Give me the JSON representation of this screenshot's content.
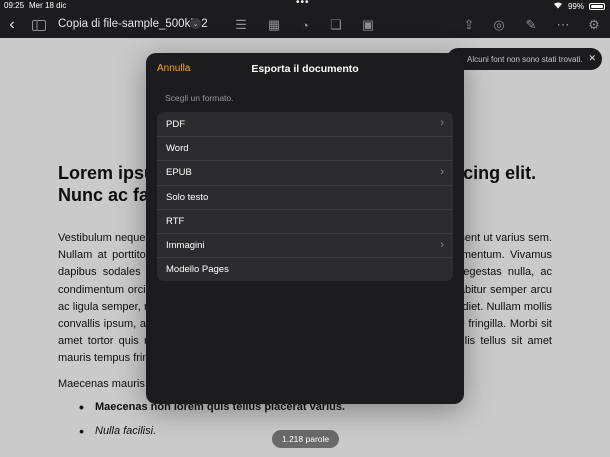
{
  "status_bar": {
    "time": "09:25",
    "date": "Mer 18 dic",
    "battery": "99%"
  },
  "toolbar": {
    "doc_title": "Copia di file-sample_500kB 2"
  },
  "document": {
    "heading": "Lorem ipsum dolor sit amet, consectetur adipiscing elit. Nunc ac faucibus odio.",
    "paragraph1": "Vestibulum neque massa, scelerisque sit amet ligula eu, congue molestie mi. Praesent ut varius sem. Nullam at porttitor arcu, nec lacinia nisi. Ut ac dolor vitae odio interdum condimentum. Vivamus dapibus sodales ex, vitae malesuada ipsum cursus convallis. Maecenas sed egestas nulla, ac condimentum orci. Mauris diam felis, vulputate ac suscipit et, iaculis non est. Curabitur semper arcu ac ligula semper, nec luctus nisl blandit. Integer lacinia ante ac libero lobortis imperdiet. Nullam mollis convallis ipsum, ac accumsan nunc vehicula vitae. Nulla eget justo in felis tristique fringilla. Morbi sit amet tortor quis risus auctor condimentum. Morbi in ullamcorper elit. Nulla iaculis tellus sit amet mauris tempus fringilla.",
    "paragraph2": "Maecenas mauris lectus, lobortis et purus mattis, blandit dictum tellus.",
    "bullet1": "Maecenas non lorem quis tellus placerat varius.",
    "bullet2": "Nulla facilisi."
  },
  "notice": {
    "text": "Alcuni font non sono stati trovati."
  },
  "word_count": "1.218 parole",
  "export_dialog": {
    "cancel_label": "Annulla",
    "title": "Esporta il documento",
    "subtitle": "Scegli un formato.",
    "formats": [
      {
        "label": "PDF",
        "has_chevron": true
      },
      {
        "label": "Word",
        "has_chevron": false
      },
      {
        "label": "EPUB",
        "has_chevron": true
      },
      {
        "label": "Solo testo",
        "has_chevron": false
      },
      {
        "label": "RTF",
        "has_chevron": false
      },
      {
        "label": "Immagini",
        "has_chevron": true
      },
      {
        "label": "Modello Pages",
        "has_chevron": false
      }
    ]
  },
  "colors": {
    "accent": "#f5a623",
    "modal_bg": "#1c1c1e",
    "row_bg": "#2c2c2e"
  }
}
